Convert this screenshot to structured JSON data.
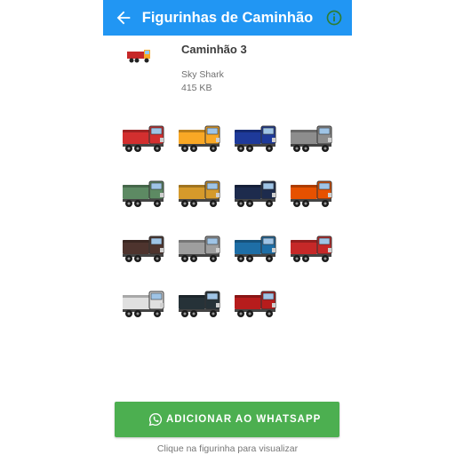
{
  "colors": {
    "appbar": "#2196f3",
    "button": "#4caf50",
    "background": "#ffffff"
  },
  "header": {
    "title": "Figurinhas de Caminhão",
    "back_icon": "arrow-left-icon",
    "info_icon": "info-circle-icon"
  },
  "pack": {
    "name": "Caminhão 3",
    "author": "Sky Shark",
    "size": "415 KB"
  },
  "stickers": [
    {
      "icon": "truck-sticker",
      "color": "#d32f2f"
    },
    {
      "icon": "truck-sticker",
      "color": "#f9a825"
    },
    {
      "icon": "truck-sticker",
      "color": "#1e3a9a"
    },
    {
      "icon": "truck-sticker",
      "color": "#8d8d8d"
    },
    {
      "icon": "truck-sticker",
      "color": "#5d8a63"
    },
    {
      "icon": "truck-sticker",
      "color": "#d59a2b"
    },
    {
      "icon": "truck-sticker",
      "color": "#1d2b4d"
    },
    {
      "icon": "truck-sticker",
      "color": "#e65100"
    },
    {
      "icon": "truck-sticker",
      "color": "#4e342e"
    },
    {
      "icon": "truck-sticker",
      "color": "#9e9e9e"
    },
    {
      "icon": "truck-sticker",
      "color": "#1e6ea6"
    },
    {
      "icon": "truck-sticker",
      "color": "#c62828"
    },
    {
      "icon": "truck-sticker",
      "color": "#e0e0e0"
    },
    {
      "icon": "truck-sticker",
      "color": "#263238"
    },
    {
      "icon": "truck-sticker",
      "color": "#b71c1c"
    }
  ],
  "actions": {
    "add_label": "ADICIONAR AO WHATSAPP",
    "add_icon": "whatsapp-icon"
  },
  "hint": "Clique na figurinha para visualizar"
}
